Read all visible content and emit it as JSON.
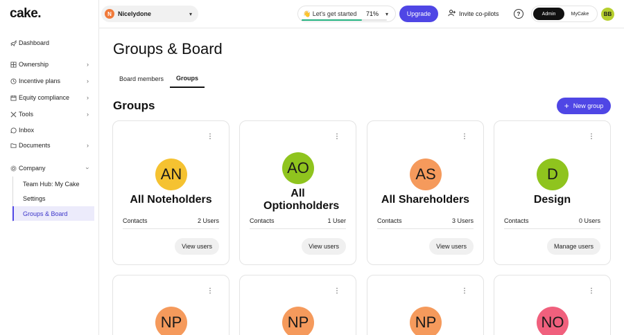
{
  "app": {
    "logo": "cake."
  },
  "sidebar": {
    "items": [
      {
        "label": "Dashboard",
        "icon": "rocket-icon",
        "chevron": false
      },
      {
        "label": "Ownership",
        "icon": "grid-icon",
        "chevron": true
      },
      {
        "label": "Incentive plans",
        "icon": "clock-icon",
        "chevron": true
      },
      {
        "label": "Equity compliance",
        "icon": "calendar-icon",
        "chevron": true
      },
      {
        "label": "Tools",
        "icon": "tools-icon",
        "chevron": true
      },
      {
        "label": "Inbox",
        "icon": "chat-icon",
        "chevron": false
      },
      {
        "label": "Documents",
        "icon": "folder-icon",
        "chevron": true
      },
      {
        "label": "Company",
        "icon": "gear-icon",
        "chevron": true
      }
    ],
    "company_sub": [
      "Team Hub: My Cake",
      "Settings",
      "Groups & Board"
    ]
  },
  "topbar": {
    "company_name": "Nicelydone",
    "company_initial": "N",
    "get_started_label": "👋 Let's get started",
    "progress_percent_label": "71%",
    "progress_fraction": 0.71,
    "upgrade_label": "Upgrade",
    "invite_label": "Invite co-pilots",
    "help_symbol": "?",
    "roles": [
      "Admin",
      "MyCake"
    ],
    "active_role": "Admin",
    "user_initials": "BB"
  },
  "main": {
    "page_title": "Groups & Board",
    "tabs": [
      {
        "label": "Board members",
        "active": false
      },
      {
        "label": "Groups",
        "active": true
      }
    ],
    "section_title": "Groups",
    "new_group_label": "New group",
    "cards": [
      {
        "initials": "AN",
        "name": "All Noteholders",
        "contacts_label": "Contacts",
        "count": "2 Users",
        "action": "View users",
        "avatar_color": "#f5c231"
      },
      {
        "initials": "AO",
        "name": "All Optionholders",
        "contacts_label": "Contacts",
        "count": "1 User",
        "action": "View users",
        "avatar_color": "#8fc41e"
      },
      {
        "initials": "AS",
        "name": "All Shareholders",
        "contacts_label": "Contacts",
        "count": "3 Users",
        "action": "View users",
        "avatar_color": "#f59a5c"
      },
      {
        "initials": "D",
        "name": "Design",
        "contacts_label": "Contacts",
        "count": "0 Users",
        "action": "Manage users",
        "avatar_color": "#8fc41e"
      },
      {
        "initials": "NP",
        "avatar_color": "#f59a5c"
      },
      {
        "initials": "NP",
        "avatar_color": "#f59a5c"
      },
      {
        "initials": "NP",
        "avatar_color": "#f59a5c"
      },
      {
        "initials": "NO",
        "avatar_color": "#f0607d"
      }
    ]
  }
}
